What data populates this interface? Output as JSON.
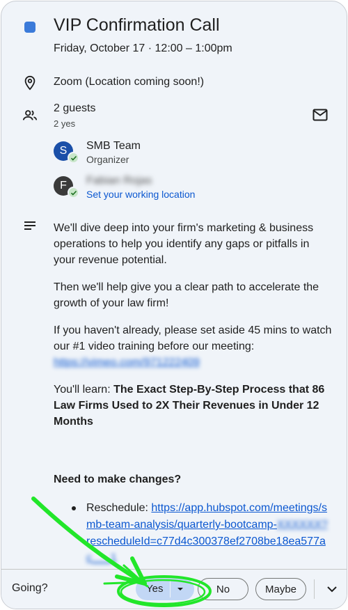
{
  "event": {
    "title": "VIP Confirmation Call",
    "datetime": "Friday, October 17  ·  12:00 – 1:00pm",
    "color": "#3b7ad9"
  },
  "location": {
    "text": "Zoom (Location coming soon!)",
    "icon": "location-pin-icon"
  },
  "guests": {
    "title": "2 guests",
    "summary": "2 yes",
    "icon": "people-icon",
    "email_icon": "mail-icon",
    "list": [
      {
        "initial": "S",
        "name": "SMB Team",
        "sub": "Organizer",
        "avatar_color": "#1a4fa8"
      },
      {
        "initial": "F",
        "name": "Fabian Rojas",
        "sub": "Set your working location",
        "avatar_color": "#3a3a3a"
      }
    ]
  },
  "description": {
    "icon": "notes-icon",
    "p1": "We'll dive deep into your firm's marketing & business operations to help you identify any gaps or pitfalls in your revenue potential.",
    "p2": "Then we'll help give you a clear path to accelerate the growth of your law firm!",
    "p3": "If you haven't already, please set aside 45 mins to watch our #1 video training before our meeting:",
    "p3_link": "https://vimeo.com/971222409",
    "p4_prefix": "You'll learn: ",
    "p4_bold": "The Exact Step-By-Step Process that 86 Law Firms Used to 2X Their Revenues in Under 12 Months",
    "changes_heading": "Need to make changes?",
    "reschedule_label": "Reschedule: ",
    "reschedule_link_a": "https://app.hubspot.com/meetings/smb-team-analysis/quarterly-bootcamp-",
    "reschedule_link_blur": "XXXXXX?",
    "reschedule_link_b": "rescheduleId=c77d4c300378ef2708be18ea577a",
    "reschedule_link_c": "c___1"
  },
  "rsvp": {
    "prompt": "Going?",
    "yes": "Yes",
    "no": "No",
    "maybe": "Maybe"
  },
  "colors": {
    "annotation": "#22e62a",
    "link": "#0b57d0"
  }
}
